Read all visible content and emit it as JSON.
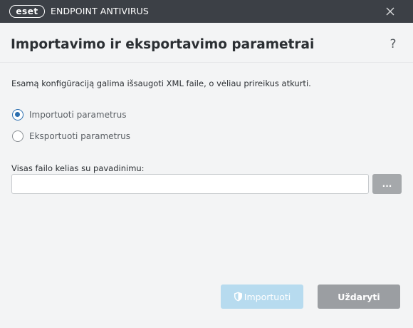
{
  "titlebar": {
    "logo_text": "eset",
    "product_name": "ENDPOINT ANTIVIRUS",
    "close_icon": "close-icon"
  },
  "dialog": {
    "title": "Importavimo ir eksportavimo parametrai",
    "help_label": "?",
    "description": "Esamą konfigūraciją galima išsaugoti XML faile, o vėliau prireikus atkurti.",
    "options": [
      {
        "label": "Importuoti parametrus",
        "checked": true
      },
      {
        "label": "Eksportuoti parametrus",
        "checked": false
      }
    ],
    "path_label": "Visas failo kelias su pavadinimu:",
    "path_value": "",
    "browse_label": "...",
    "import_label": "Importuoti",
    "import_icon": "shield-icon",
    "close_label": "Uždaryti"
  },
  "colors": {
    "titlebar_bg": "#3c4046",
    "accent": "#2c6fb0",
    "import_disabled": "#b7dbef",
    "close_button": "#9b9ea2"
  }
}
